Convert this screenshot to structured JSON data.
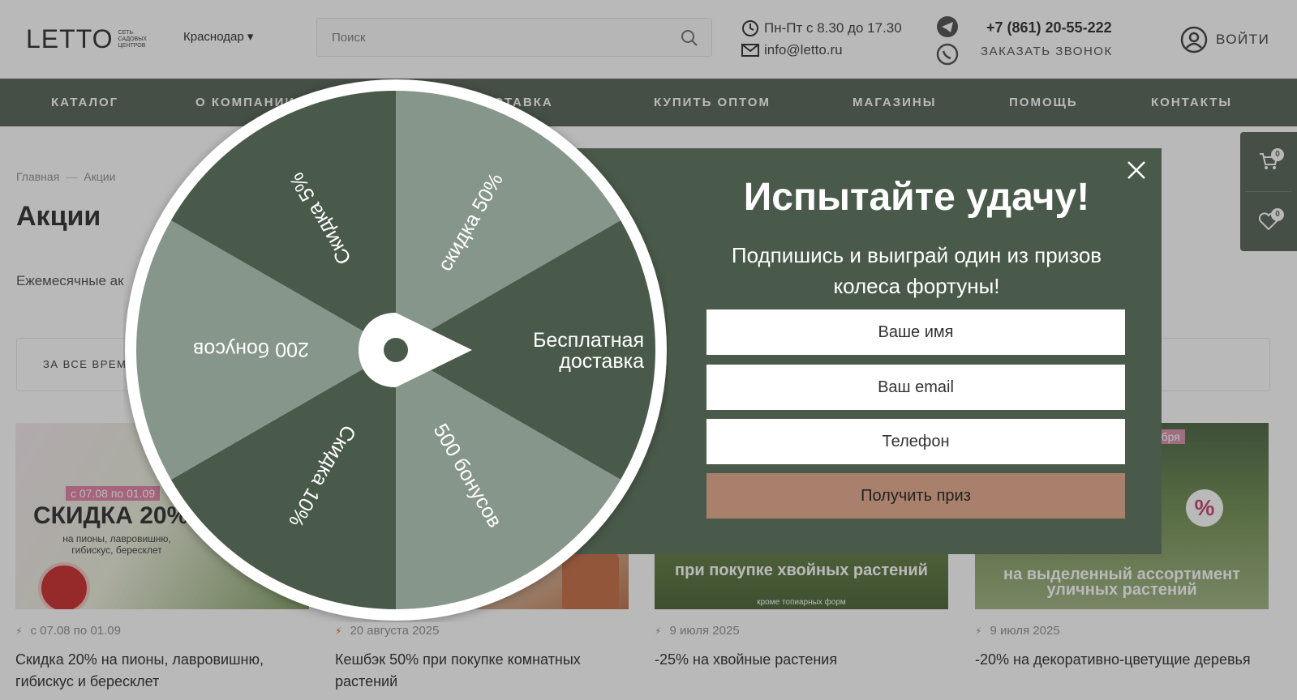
{
  "header": {
    "logo": "LETTO",
    "logo_sub": "СЕТЬ САДОВЫХ ЦЕНТРОВ",
    "city": "Краснодар ▾",
    "search_placeholder": "Поиск",
    "hours": "Пн-Пт с 8.30 до 17.30",
    "email": "info@letto.ru",
    "phone": "+7 (861) 20-55-222",
    "callback": "ЗАКАЗАТЬ ЗВОНОК",
    "login": "ВОЙТИ",
    "icons": [
      "clock-icon",
      "mail-icon",
      "telegram-icon",
      "whatsapp-icon",
      "user-icon",
      "search-icon"
    ]
  },
  "nav": {
    "items": [
      {
        "label": "КАТАЛОГ"
      },
      {
        "label": "О КОМПАНИИ"
      },
      {
        "label": "ДОСТАВКА"
      },
      {
        "label": "КУПИТЬ ОПТОМ"
      },
      {
        "label": "МАГАЗИНЫ"
      },
      {
        "label": "ПОМОЩЬ"
      },
      {
        "label": "КОНТАКТЫ"
      }
    ]
  },
  "breadcrumb": {
    "home": "Главная",
    "sep": "—",
    "current": "Акции"
  },
  "page": {
    "title": "Акции",
    "description": "Ежемесячные ак",
    "filter": "ЗА ВСЕ ВРЕМЯ"
  },
  "side": {
    "cart_count": "0",
    "wishlist_count": "0"
  },
  "cards": [
    {
      "date": "с 07.08 по 01.09",
      "title": "Скидка 20% на пионы, лавровишню, гибискус и бересклет",
      "image_tag": "с 07.08 по 01.09",
      "image_headline": "СКИДКА 20%",
      "image_caption": "на пионы, лавровишню, гибискус, бересклет"
    },
    {
      "date": "20 августа 2025",
      "title": "Кешбэк 50% при покупке комнатных растений"
    },
    {
      "date": "9 июля 2025",
      "title": "-25% на хвойные растения",
      "image_caption": "при покупке хвойных растений",
      "image_note": "кроме топиарных форм"
    },
    {
      "date": "9 июля 2025",
      "title": "-20% на декоративно-цветущие деревья",
      "image_tag": "ября",
      "image_caption": "на выделенный ассортимент уличных растений"
    }
  ],
  "popup": {
    "title": "Испытайте удачу!",
    "subtitle": "Подпишись и выиграй один из призов колеса фортуны!",
    "name_placeholder": "Ваше имя",
    "email_placeholder": "Ваш email",
    "phone_placeholder": "Телефон",
    "submit": "Получить приз"
  },
  "wheel": {
    "segments": [
      {
        "label": "скидка 50%",
        "color": "#86968a"
      },
      {
        "label": "Бесплатная доставка",
        "color": "#4a5a4a"
      },
      {
        "label": "500 бонусов",
        "color": "#86968a"
      },
      {
        "label": "Скидка 10%",
        "color": "#4a5a4a"
      },
      {
        "label": "200 бонусов",
        "color": "#86968a"
      },
      {
        "label": "Скидка 5%",
        "color": "#4a5a4a"
      }
    ]
  },
  "colors": {
    "primary": "#4a5a4a",
    "wheel_light": "#86968a",
    "accent_button": "#a8806b"
  }
}
